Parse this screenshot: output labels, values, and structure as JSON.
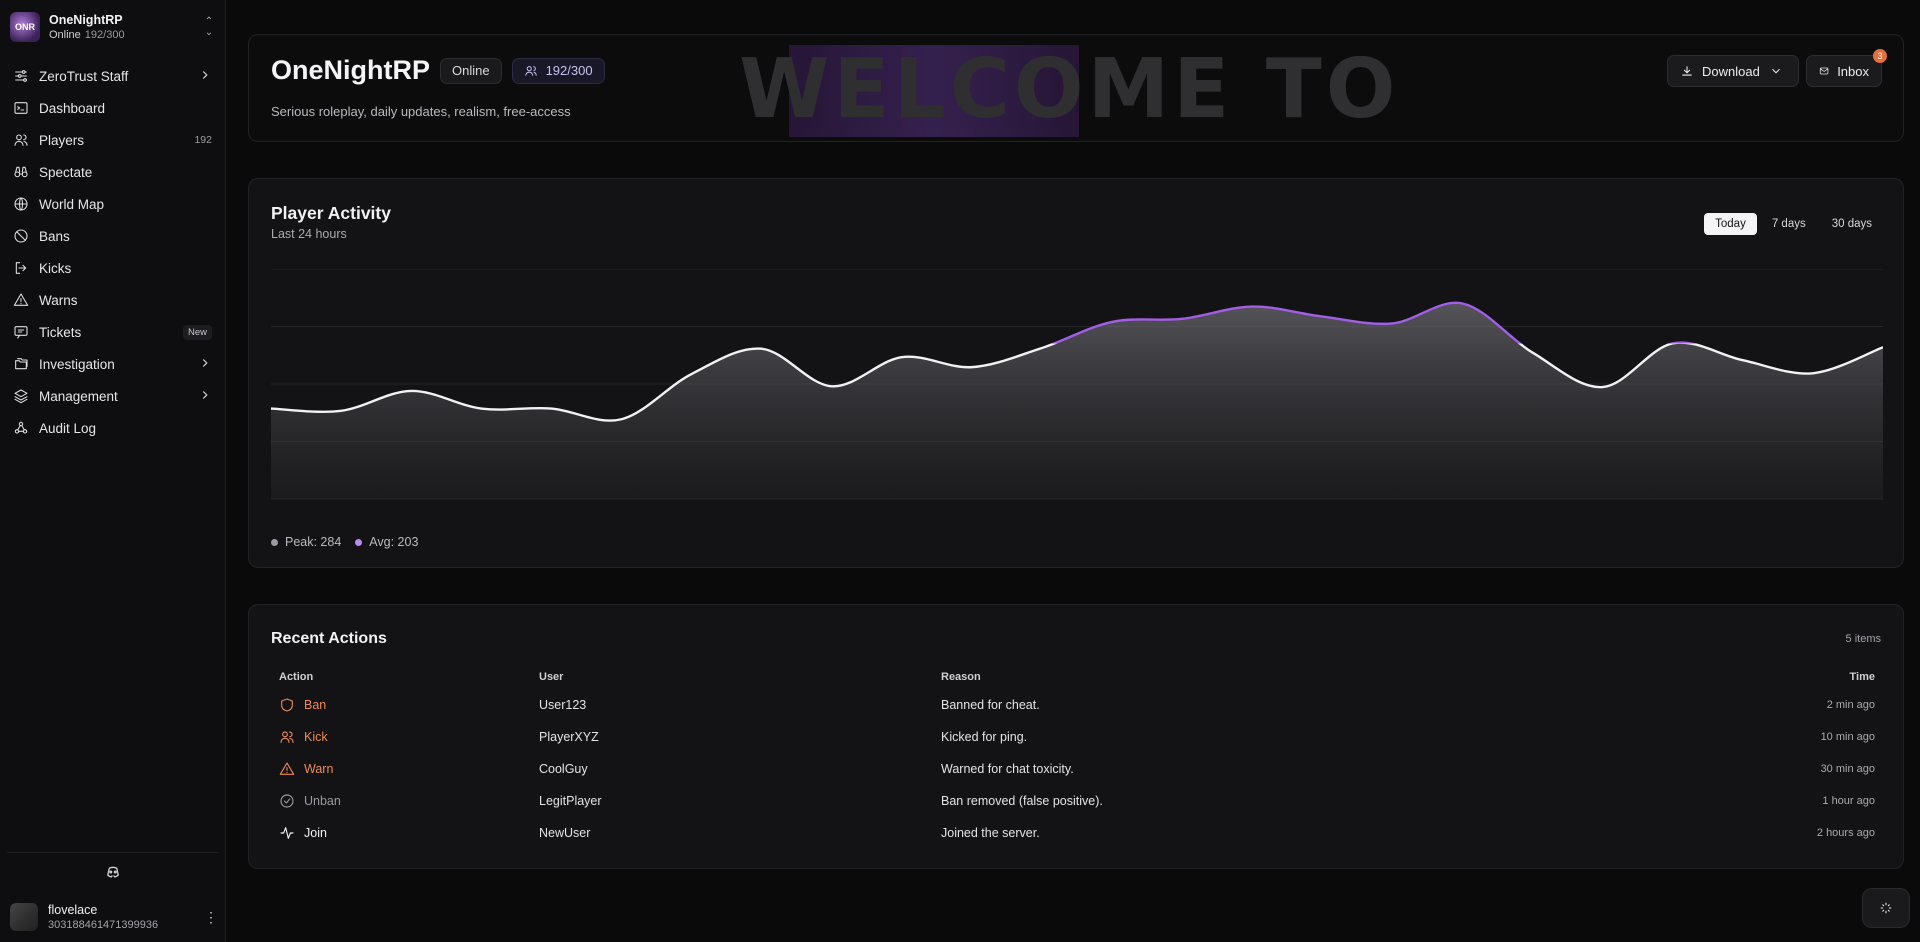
{
  "brand": {
    "name": "OneNightRP",
    "status": "Online",
    "count": "192/300",
    "logo_text": "ONR"
  },
  "nav": [
    {
      "label": "ZeroTrust Staff",
      "icon": "sliders-icon",
      "chevron": true
    },
    {
      "label": "Dashboard",
      "icon": "terminal-icon"
    },
    {
      "label": "Players",
      "icon": "users-icon",
      "badge": "192"
    },
    {
      "label": "Spectate",
      "icon": "binoculars-icon"
    },
    {
      "label": "World Map",
      "icon": "globe-icon"
    },
    {
      "label": "Bans",
      "icon": "ban-icon"
    },
    {
      "label": "Kicks",
      "icon": "logout-icon"
    },
    {
      "label": "Warns",
      "icon": "warning-icon"
    },
    {
      "label": "Tickets",
      "icon": "message-icon",
      "badge_new": "New"
    },
    {
      "label": "Investigation",
      "icon": "folders-icon",
      "chevron": true
    },
    {
      "label": "Management",
      "icon": "layers-icon",
      "chevron": true
    },
    {
      "label": "Audit Log",
      "icon": "webhook-icon"
    }
  ],
  "user": {
    "name": "flovelace",
    "id": "303188461471399936"
  },
  "hero": {
    "title": "OneNightRP",
    "status_chip": "Online",
    "players_chip": "192/300",
    "description": "Serious roleplay, daily updates, realism, free-access",
    "banner_text": "WELCOME TO",
    "download_label": "Download",
    "inbox_label": "Inbox",
    "inbox_badge": "3"
  },
  "activity": {
    "title": "Player Activity",
    "subtitle": "Last 24 hours",
    "ranges": [
      "Today",
      "7 days",
      "30 days"
    ],
    "active_range": "Today",
    "peak_label": "Peak: 284",
    "avg_label": "Avg: 203",
    "colors": {
      "below": "#f2f2f4",
      "above": "#a35de6",
      "peak_dot": "#9b9ba3",
      "avg_dot": "#b78cf0"
    }
  },
  "chart_data": {
    "type": "area",
    "title": "Player Activity",
    "x": [
      0,
      1,
      2,
      3,
      4,
      5,
      6,
      7,
      8,
      9,
      10,
      11,
      12,
      13,
      14,
      15,
      16,
      17,
      18,
      19,
      20,
      21,
      22,
      23
    ],
    "values": [
      118,
      115,
      141,
      118,
      118,
      104,
      163,
      196,
      147,
      185,
      172,
      197,
      231,
      235,
      251,
      238,
      229,
      255,
      191,
      146,
      203,
      181,
      164,
      198
    ],
    "ylim": [
      0,
      300
    ],
    "threshold": 203,
    "grid": true
  },
  "recent": {
    "title": "Recent Actions",
    "count": "5 items",
    "columns": [
      "Action",
      "User",
      "Reason",
      "Time"
    ],
    "rows": [
      {
        "action": "Ban",
        "icon": "shield-icon",
        "color": "#ec8a55",
        "user": "User123",
        "reason": "Banned for cheat.",
        "time": "2 min ago"
      },
      {
        "action": "Kick",
        "icon": "users-icon",
        "color": "#ec8a55",
        "user": "PlayerXYZ",
        "reason": "Kicked for ping.",
        "time": "10 min ago"
      },
      {
        "action": "Warn",
        "icon": "warning-icon",
        "color": "#ec8a55",
        "user": "CoolGuy",
        "reason": "Warned for chat toxicity.",
        "time": "30 min ago"
      },
      {
        "action": "Unban",
        "icon": "check-circle-icon",
        "color": "#9a9aa2",
        "user": "LegitPlayer",
        "reason": "Ban removed (false positive).",
        "time": "1 hour ago"
      },
      {
        "action": "Join",
        "icon": "activity-icon",
        "color": "#f2f2f4",
        "user": "NewUser",
        "reason": "Joined the server.",
        "time": "2 hours ago"
      }
    ]
  }
}
